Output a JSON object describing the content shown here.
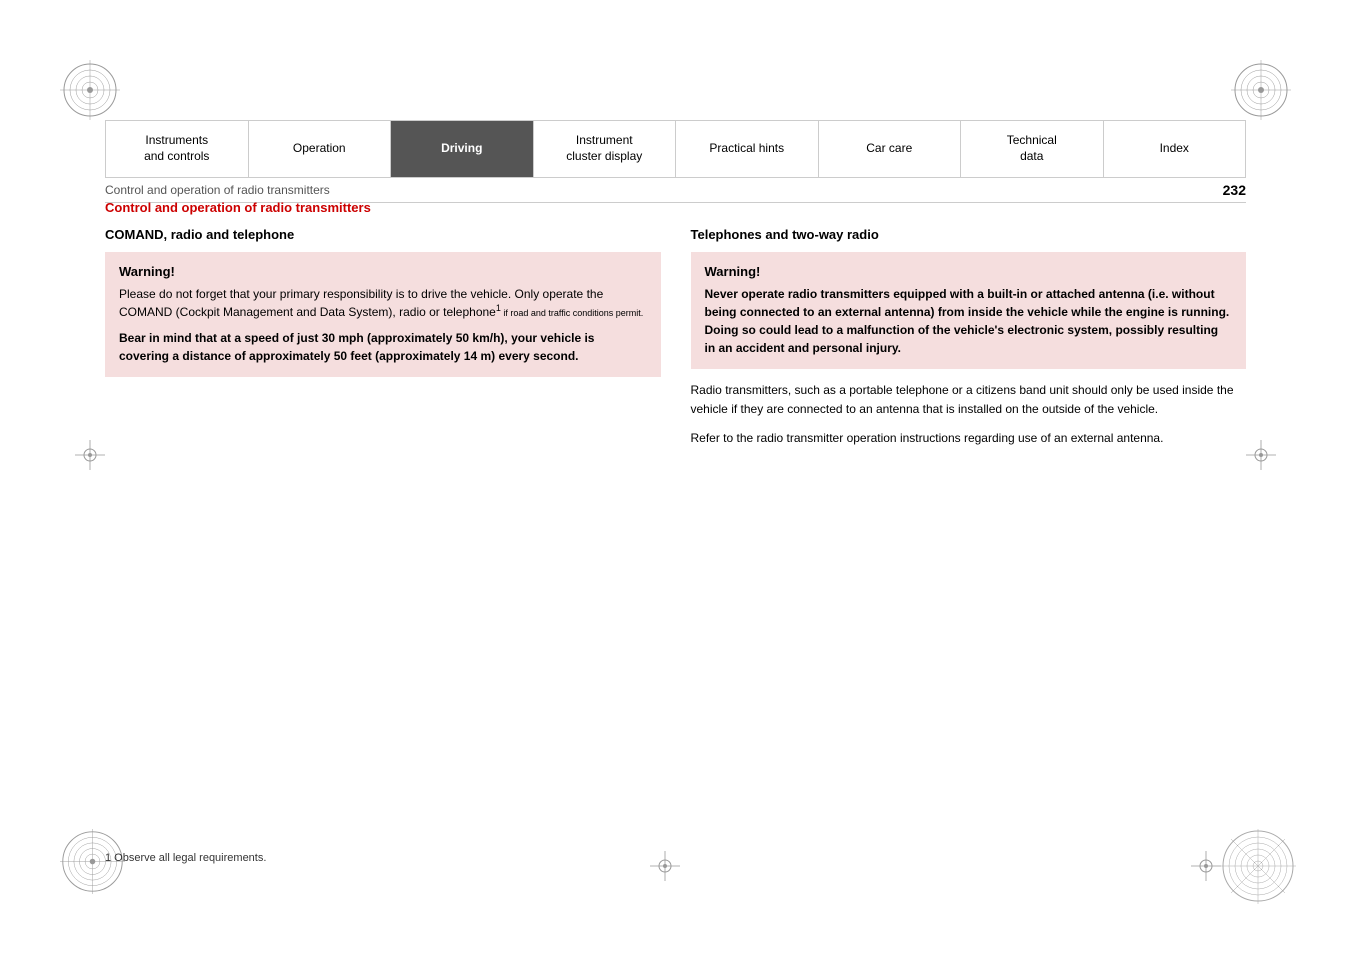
{
  "nav": {
    "items": [
      {
        "label": "Instruments\nand controls",
        "active": false,
        "id": "instruments"
      },
      {
        "label": "Operation",
        "active": false,
        "id": "operation"
      },
      {
        "label": "Driving",
        "active": true,
        "id": "driving"
      },
      {
        "label": "Instrument\ncluster display",
        "active": false,
        "id": "instrument-cluster"
      },
      {
        "label": "Practical hints",
        "active": false,
        "id": "practical-hints"
      },
      {
        "label": "Car care",
        "active": false,
        "id": "car-care"
      },
      {
        "label": "Technical\ndata",
        "active": false,
        "id": "technical-data"
      },
      {
        "label": "Index",
        "active": false,
        "id": "index"
      }
    ]
  },
  "breadcrumb": "Control and operation of radio transmitters",
  "page_number": "232",
  "section_title": "Control and operation of radio transmitters",
  "left_column": {
    "subtitle": "COMAND, radio and telephone",
    "warning": {
      "title": "Warning!",
      "text_normal": "Please do not forget that your primary responsibility is to drive the vehicle. Only operate the COMAND (Cockpit Management and Data System), radio or telephone",
      "footnote_ref": "1",
      "footnote_text": "if road and traffic conditions permit.",
      "text_bold": "Bear in mind that at a speed of just 30 mph (approximately 50 km/h), your vehicle is covering a distance of approximately 50 feet (approximately 14 m) every second."
    }
  },
  "right_column": {
    "subtitle": "Telephones and two-way radio",
    "warning": {
      "title": "Warning!",
      "text_bold": "Never operate radio transmitters equipped with a built-in or attached antenna (i.e. without being connected to an external antenna) from inside the vehicle while the engine is running. Doing so could lead to a malfunction of the vehicle's electronic system, possibly resulting in an accident and personal injury."
    },
    "body_text_1": "Radio transmitters, such as a portable telephone or a citizens band unit should only be used inside the vehicle if they are connected to an antenna that is installed on the outside of the vehicle.",
    "body_text_2": "Refer to the radio transmitter operation instructions regarding use of an external antenna."
  },
  "footnote": "1    Observe all legal requirements."
}
